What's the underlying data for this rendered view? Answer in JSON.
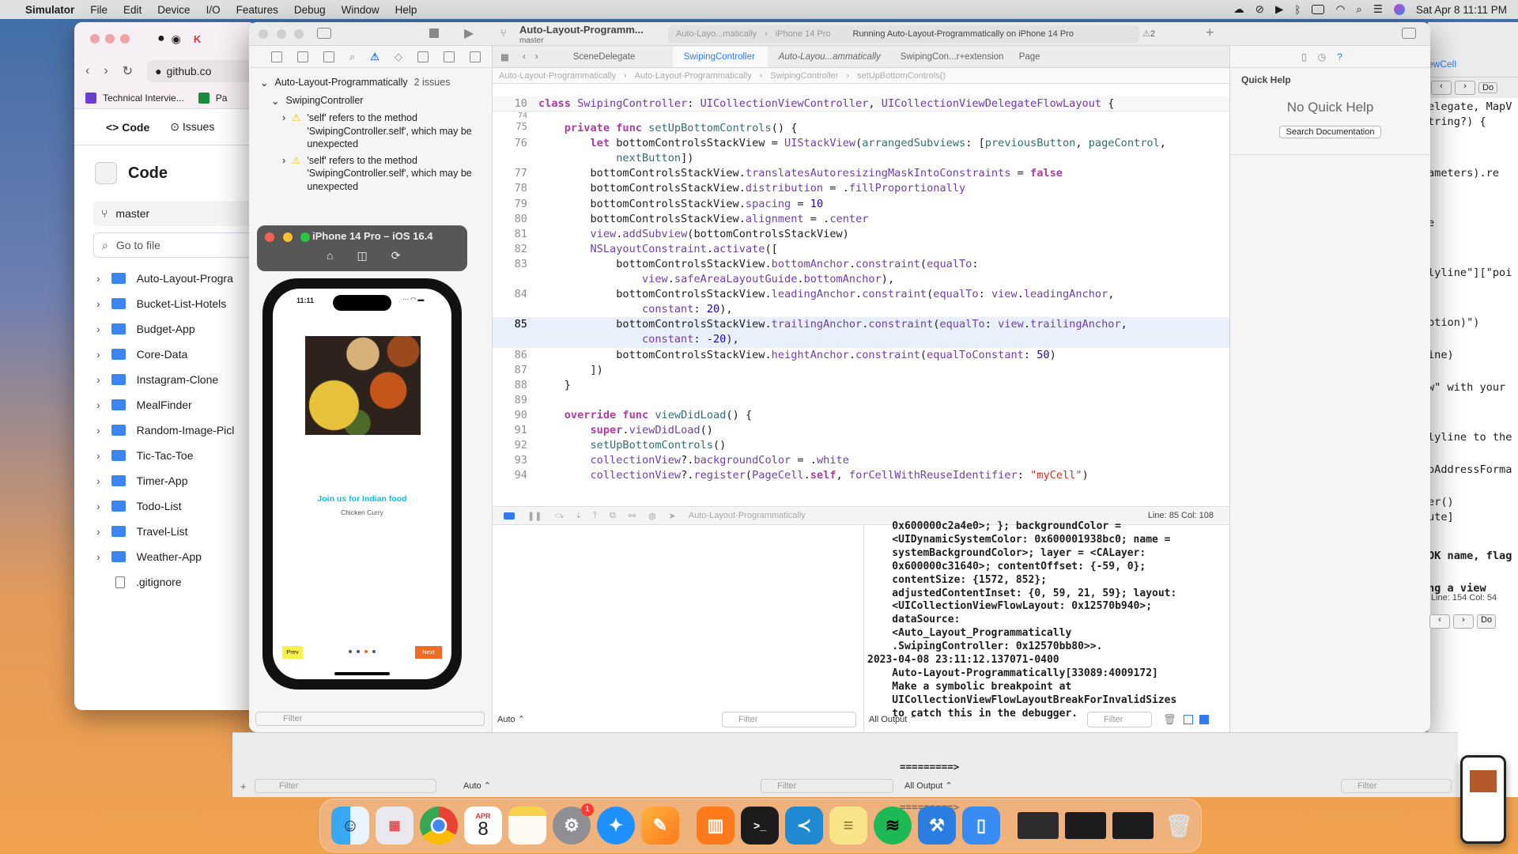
{
  "menubar": {
    "app_name": "Simulator",
    "items": [
      "File",
      "Edit",
      "Device",
      "I/O",
      "Features",
      "Debug",
      "Window",
      "Help"
    ],
    "datetime": "Sat Apr 8  11:11 PM"
  },
  "safari": {
    "url": "github.co",
    "bookmarks": [
      "Technical Intervie...",
      "Pa"
    ],
    "tabs": [
      "Code",
      "Issues"
    ],
    "sidebar_title": "Code",
    "branch": "master",
    "search_placeholder": "Go to file",
    "files": [
      "Auto-Layout-Progra",
      "Bucket-List-Hotels",
      "Budget-App",
      "Core-Data",
      "Instagram-Clone",
      "MealFinder",
      "Random-Image-Picl",
      "Tic-Tac-Toe",
      "Timer-App",
      "Todo-List",
      "Travel-List",
      "Weather-App"
    ],
    "gitignore": ".gitignore"
  },
  "xcode": {
    "project_name": "Auto-Layout-Programm...",
    "branch": "master",
    "scheme": "Auto-Layo...matically",
    "device": "iPhone 14 Pro",
    "status": "Running Auto-Layout-Programmatically on iPhone 14 Pro",
    "warning_count": "2",
    "editor_tabs": [
      "SceneDelegate",
      "SwipingController",
      "Auto-Layou...ammatically",
      "SwipingCon...r+extension",
      "Page"
    ],
    "breadcrumb": [
      "Auto-Layout-Programmatically",
      "Auto-Layout-Programmatically",
      "SwipingController",
      "setUpBottomControls()"
    ],
    "issue_navigator": {
      "project": "Auto-Layout-Programmatically",
      "project_issues": "2 issues",
      "file": "SwipingController",
      "issues": [
        "'self' refers to the method 'SwipingController.self', which may be unexpected",
        "'self' refers to the method 'SwipingController.self', which may be unexpected"
      ]
    },
    "filter_placeholder": "Filter",
    "cursor_position": "Line: 85  Col: 108",
    "debug_scheme": "Auto-Layout-Programmatically",
    "console_output_label": "All Output",
    "auto_label": "Auto",
    "console_lines": [
      "    0x600000c2a4e0>; }; backgroundColor =",
      "    <UIDynamicSystemColor: 0x600001938bc0; name =",
      "    systemBackgroundColor>; layer = <CALayer:",
      "    0x600000c31640>; contentOffset: {-59, 0};",
      "    contentSize: {1572, 852};",
      "    adjustedContentInset: {0, 59, 21, 59}; layout:",
      "    <UICollectionViewFlowLayout: 0x12570b940>;",
      "    dataSource:",
      "    <Auto_Layout_Programmatically",
      "    .SwipingController: 0x12570bb80>>.",
      "2023-04-08 23:11:12.137071-0400",
      "    Auto-Layout-Programmatically[33089:4009172]",
      "    Make a symbolic breakpoint at",
      "    UICollectionViewFlowLayoutBreakForInvalidSizes",
      "    to catch this in the debugger."
    ],
    "quick_help": {
      "title": "Quick Help",
      "empty": "No Quick Help",
      "button": "Search Documentation"
    }
  },
  "back_window": {
    "lines": [
      "elegate, MapV",
      "tring?) {",
      "ameters).re",
      "e",
      "lyline\"][\"poi",
      "ption)\")",
      "ine)",
      "w\" with your",
      "lyline to the",
      "oAddressForma",
      "er()",
      "ute]",
      "OK name, flag",
      "ng a view"
    ],
    "cursor_position": "Line: 154  Col: 54",
    "console": [
      "=========>",
      "=========>"
    ],
    "tab_fragment": "ewCell",
    "button_fragment": "Do"
  },
  "simulator": {
    "title": "iPhone 14 Pro – iOS 16.4",
    "time": "11:11",
    "headline": "Join us for Indian food",
    "subtitle": "Chicken Curry",
    "prev": "Prev",
    "next": "Next",
    "page_count": 4,
    "current_page": 2
  },
  "dock": {
    "apps": [
      "Finder",
      "Launchpad",
      "Chrome",
      "Calendar",
      "Notes",
      "System Settings",
      "Safari",
      "Pages",
      "Books",
      "Terminal",
      "VS Code",
      "Stickies",
      "Spotify",
      "Xcode",
      "Simulator"
    ],
    "calendar_month": "APR",
    "calendar_day": "8",
    "settings_badge": "1"
  },
  "colors": {
    "accent": "#2f7bf6",
    "warning": "#f5c400",
    "headline": "#00c8e6",
    "prev_bg": "#f7f14a",
    "next_bg": "#f36b22"
  }
}
